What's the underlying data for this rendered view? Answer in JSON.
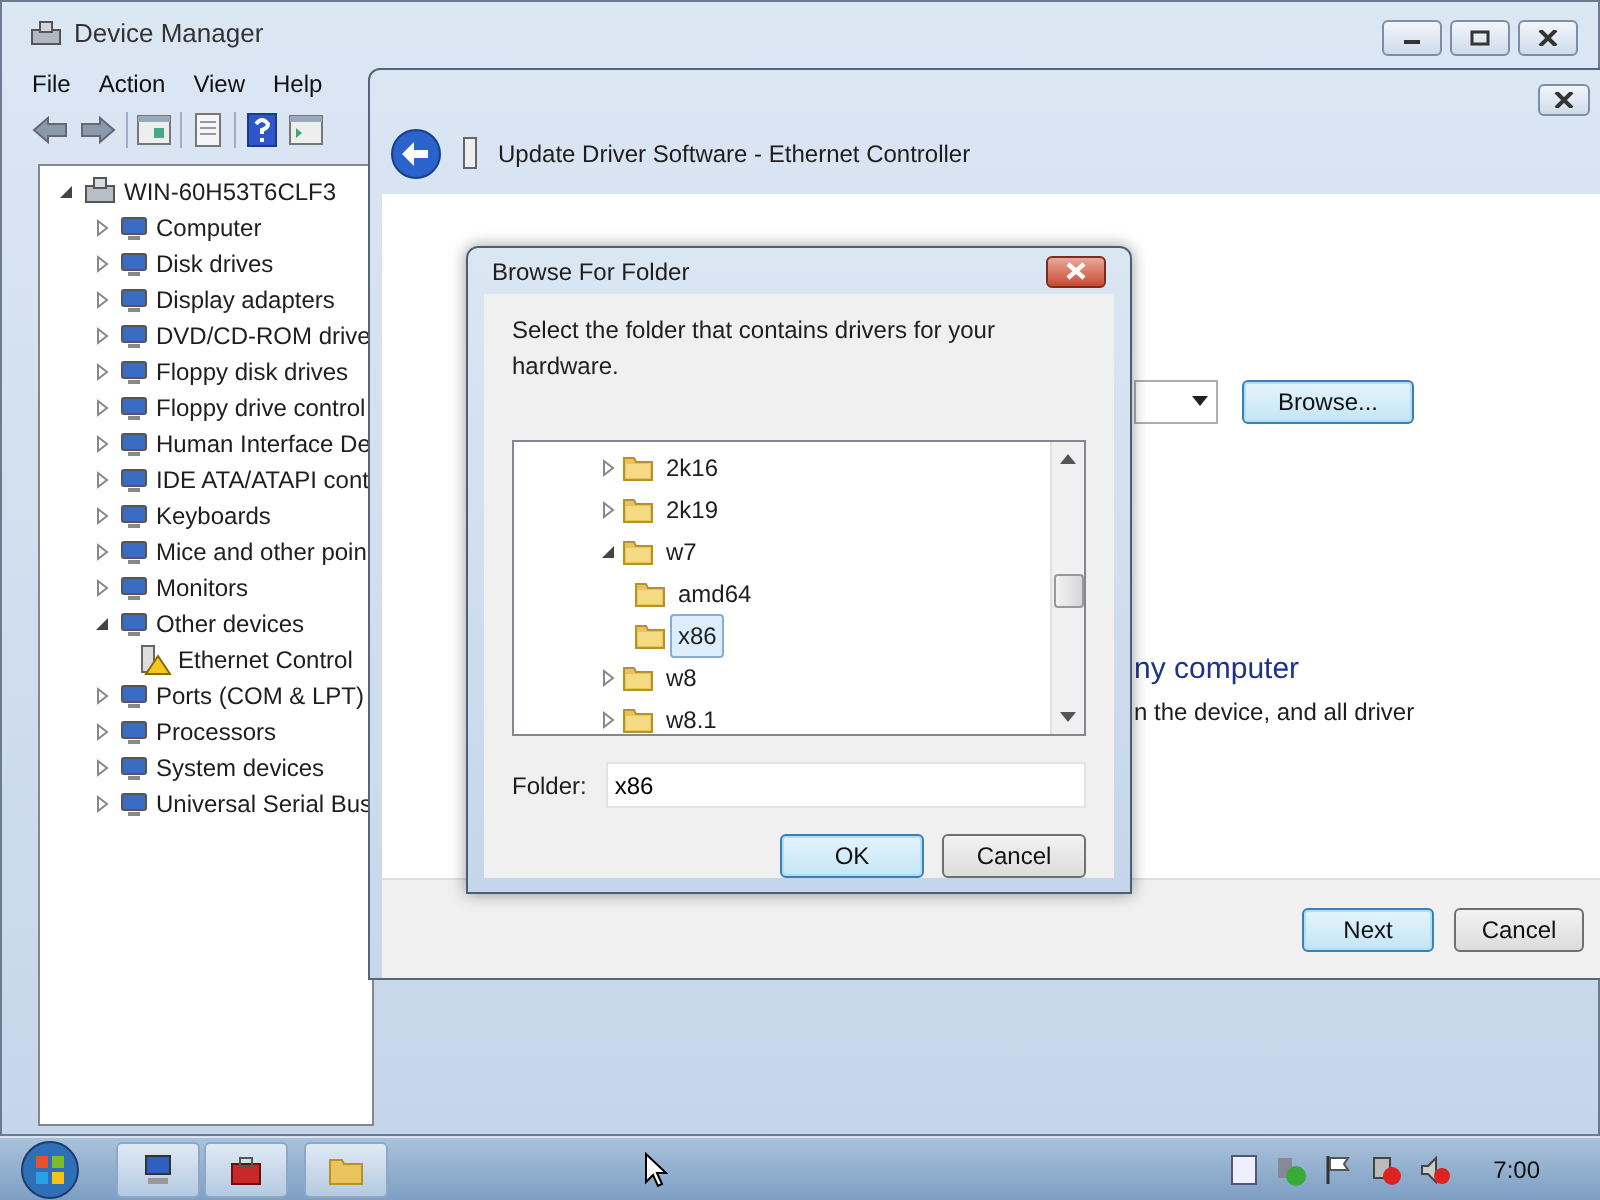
{
  "device_manager": {
    "title": "Device Manager",
    "menu": [
      {
        "label": "File"
      },
      {
        "label": "Action"
      },
      {
        "label": "View"
      },
      {
        "label": "Help"
      }
    ],
    "tree": {
      "label": "WIN-60H53T6CLF3",
      "expanded": true,
      "children": [
        {
          "label": "Computer",
          "expanded": false
        },
        {
          "label": "Disk drives",
          "expanded": false
        },
        {
          "label": "Display adapters",
          "expanded": false
        },
        {
          "label": "DVD/CD-ROM drive",
          "expanded": false
        },
        {
          "label": "Floppy disk drives",
          "expanded": false
        },
        {
          "label": "Floppy drive control",
          "expanded": false
        },
        {
          "label": "Human Interface De",
          "expanded": false
        },
        {
          "label": "IDE ATA/ATAPI cont",
          "expanded": false
        },
        {
          "label": "Keyboards",
          "expanded": false
        },
        {
          "label": "Mice and other poin",
          "expanded": false
        },
        {
          "label": "Monitors",
          "expanded": false
        },
        {
          "label": "Other devices",
          "expanded": true,
          "children": [
            {
              "label": "Ethernet Control",
              "warning": true
            }
          ]
        },
        {
          "label": "Ports (COM & LPT)",
          "expanded": false
        },
        {
          "label": "Processors",
          "expanded": false
        },
        {
          "label": "System devices",
          "expanded": false
        },
        {
          "label": "Universal Serial Bus",
          "expanded": false
        }
      ]
    }
  },
  "wizard": {
    "title": "Update Driver Software - Ethernet Controller",
    "browse_button": "Browse...",
    "option_title": "ny computer",
    "option_text": "n the device, and all driver",
    "next_button": "Next",
    "cancel_button": "Cancel"
  },
  "browse_dialog": {
    "title": "Browse For Folder",
    "instruction": "Select the folder that contains drivers for your hardware.",
    "folders": [
      {
        "label": "2k16",
        "expanded": false,
        "selected": false
      },
      {
        "label": "2k19",
        "expanded": false,
        "selected": false
      },
      {
        "label": "w7",
        "expanded": true,
        "selected": false,
        "children": [
          {
            "label": "amd64",
            "selected": false
          },
          {
            "label": "x86",
            "selected": true
          }
        ]
      },
      {
        "label": "w8",
        "expanded": false,
        "selected": false
      },
      {
        "label": "w8.1",
        "expanded": false,
        "selected": false
      }
    ],
    "folder_label": "Folder:",
    "folder_value": "x86",
    "ok_button": "OK",
    "cancel_button": "Cancel"
  },
  "taskbar": {
    "clock": "7:00"
  }
}
